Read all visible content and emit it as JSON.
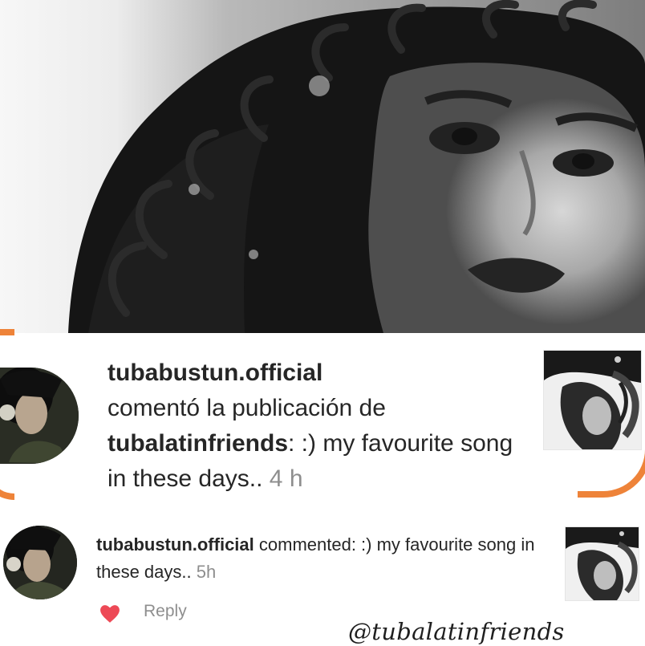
{
  "notifications": [
    {
      "username": "tubabustun.official",
      "action_text": " comentó la publicación de ",
      "target_user": "tubalatinfriends",
      "comment": ": :) my favourite song in these days..",
      "time": "4 h"
    },
    {
      "username": "tubabustun.official",
      "action_text": " commented: :) my favourite song in these days..",
      "time": "5h",
      "reply_label": "Reply"
    }
  ],
  "watermark": "@tubalatinfriends",
  "colors": {
    "accent_orange": "#ee7d2f",
    "text_primary": "#262626",
    "text_secondary": "#8e8e8e",
    "heart_red": "#ed4956"
  },
  "icons": {
    "heart": "heart-icon"
  }
}
